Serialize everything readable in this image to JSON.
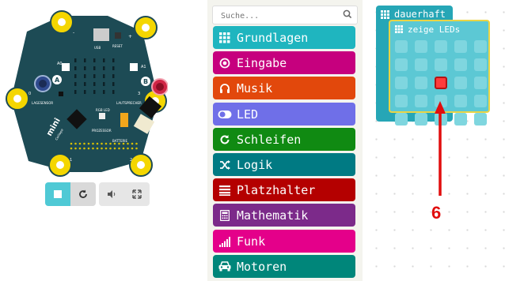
{
  "simulator": {
    "board_labels": {
      "usb": "USB",
      "reset": "RESET",
      "a0": "A0",
      "a1": "A1",
      "button_a": "A",
      "button_b": "B",
      "lagesensor": "LAGESENSOR",
      "lautsprecher": "LAUTSPRECHER",
      "rgb_led": "RGB LED",
      "prozessor": "PROZESSOR",
      "batterie": "BATTERIE",
      "brand": "mini",
      "brand_small": "Calliope",
      "pin0": "0",
      "pin1": "1",
      "pin2": "2",
      "pin3": "3",
      "pin_plus": "+",
      "pin_minus": "-"
    },
    "toolbar": [
      {
        "name": "stop-button",
        "icon": "stop-icon"
      },
      {
        "name": "restart-button",
        "icon": "restart-icon"
      },
      {
        "name": "mute-button",
        "icon": "speaker-icon"
      },
      {
        "name": "fullscreen-button",
        "icon": "expand-icon"
      }
    ]
  },
  "categories": {
    "search_placeholder": "Suche...",
    "items": [
      {
        "label": "Grundlagen",
        "color": "#1fb5bf",
        "icon": "grid-icon"
      },
      {
        "label": "Eingabe",
        "color": "#c6007e",
        "icon": "target-icon"
      },
      {
        "label": "Musik",
        "color": "#e2480c",
        "icon": "headphones-icon"
      },
      {
        "label": "LED",
        "color": "#6f6fe8",
        "icon": "toggle-icon"
      },
      {
        "label": "Schleifen",
        "color": "#108a12",
        "icon": "refresh-icon"
      },
      {
        "label": "Logik",
        "color": "#007a83",
        "icon": "shuffle-icon"
      },
      {
        "label": "Platzhalter",
        "color": "#b40000",
        "icon": "list-icon"
      },
      {
        "label": "Mathematik",
        "color": "#7c2a8a",
        "icon": "calculator-icon"
      },
      {
        "label": "Funk",
        "color": "#e4008a",
        "icon": "signal-icon"
      },
      {
        "label": "Motoren",
        "color": "#00867a",
        "icon": "car-icon"
      }
    ]
  },
  "workspace": {
    "outer_block_label": "dauerhaft",
    "inner_block_label": "zeige LEDs",
    "led_on_index": 12,
    "annotation_number": "6",
    "colors": {
      "outer_block": "#26a6b6",
      "inner_block": "#5cc8d4",
      "inner_border": "#e9d445",
      "led_off": "#7fd6df",
      "led_on": "#ff3b3b",
      "annotation": "#e10d0d"
    }
  }
}
